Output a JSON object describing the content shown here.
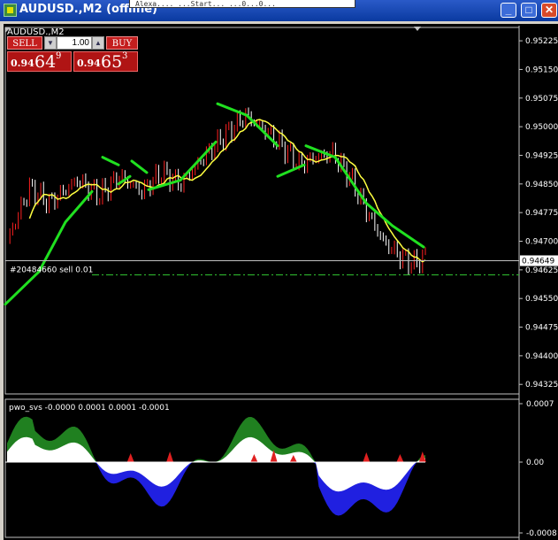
{
  "window": {
    "title": "AUDUSD.,M2 (offline)",
    "top_strip_text": "Alexa.... ...Start... ...0...0...",
    "minimize": "_",
    "maximize": "□",
    "close": "✕"
  },
  "chart": {
    "symbol_label": "AUDUSD.,M2",
    "current_price_label": "0.94649",
    "order_line_label": "#20484660 sell 0.01",
    "price_axis": [
      "0.95225",
      "0.95150",
      "0.95075",
      "0.95000",
      "0.94925",
      "0.94850",
      "0.94775",
      "0.94700",
      "0.94625",
      "0.94550",
      "0.94475",
      "0.94400",
      "0.94325"
    ],
    "price_range": [
      0.943,
      0.9526
    ]
  },
  "one_click": {
    "sell_label": "SELL",
    "buy_label": "BUY",
    "lots": "1.00",
    "bid_base": "0.94",
    "bid_big": "64",
    "bid_sup": "9",
    "ask_base": "0.94",
    "ask_big": "65",
    "ask_sup": "3"
  },
  "indicator": {
    "label": "pwo_svs -0.0000 0.0001 0.0001 -0.0001",
    "axis": [
      "0.0007",
      "0.00",
      "-0.0008"
    ]
  },
  "colors": {
    "up": "#ff2020",
    "down": "#ffffff",
    "ma": "#ffff40",
    "trend": "#20e020",
    "osc_green": "#208020",
    "osc_blue": "#2020e0",
    "osc_red": "#e02020"
  }
}
